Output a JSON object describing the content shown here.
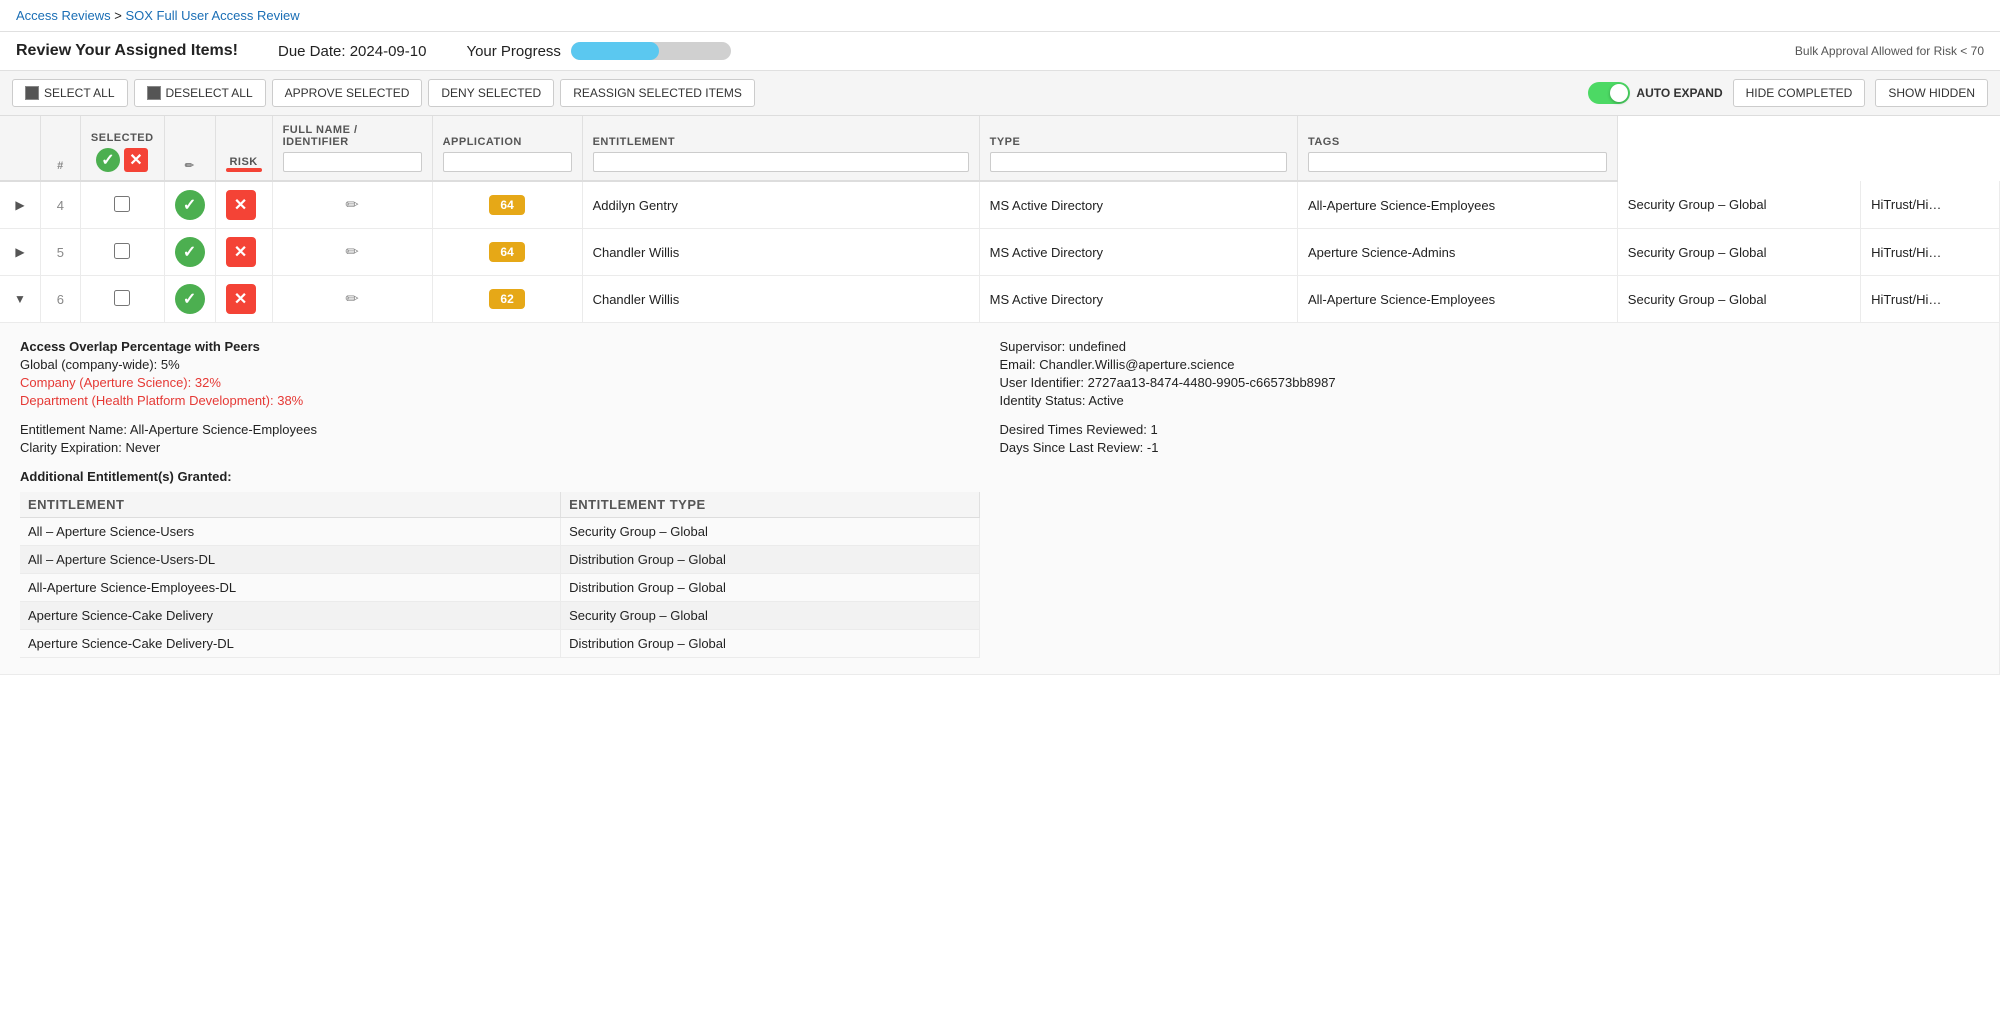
{
  "breadcrumb": {
    "parent_label": "Access Reviews",
    "parent_href": "#",
    "separator": ">",
    "current_label": "SOX Full User Access Review"
  },
  "header": {
    "title": "Review Your Assigned Items!",
    "due_date_label": "Due Date: 2024-09-10",
    "progress_label": "Your Progress",
    "progress_percent": 55,
    "bulk_approval_label": "Bulk Approval Allowed for Risk < 70"
  },
  "toolbar": {
    "select_all_label": "SELECT ALL",
    "deselect_all_label": "DESELECT ALL",
    "approve_selected_label": "APPROVE SELECTED",
    "deny_selected_label": "DENY SELECTED",
    "reassign_label": "REASSIGN SELECTED ITEMS",
    "auto_expand_label": "AUTO EXPAND",
    "hide_completed_label": "HIDE COMPLETED",
    "show_hidden_label": "SHOW HIDDEN"
  },
  "table": {
    "columns": {
      "num": "#",
      "selected": "SELECTED",
      "risk": "RISK",
      "full_name": "FULL NAME / IDENTIFIER",
      "application": "APPLICATION",
      "entitlement": "ENTITLEMENT",
      "type": "TYPE",
      "tags": "TAGS"
    },
    "rows": [
      {
        "id": 4,
        "selected": false,
        "risk": 64,
        "risk_class": "amber",
        "full_name": "Addilyn Gentry",
        "application": "MS Active Directory",
        "entitlement": "All-Aperture Science-Employees",
        "type": "Security Group – Global",
        "tags": "HiTrust/Hi…",
        "expanded": false
      },
      {
        "id": 5,
        "selected": false,
        "risk": 64,
        "risk_class": "amber",
        "full_name": "Chandler Willis",
        "application": "MS Active Directory",
        "entitlement": "Aperture Science-Admins",
        "type": "Security Group – Global",
        "tags": "HiTrust/Hi…",
        "expanded": false
      },
      {
        "id": 6,
        "selected": false,
        "risk": 62,
        "risk_class": "amber",
        "full_name": "Chandler Willis",
        "application": "MS Active Directory",
        "entitlement": "All-Aperture Science-Employees",
        "type": "Security Group – Global",
        "tags": "HiTrust/Hi…",
        "expanded": true
      }
    ]
  },
  "expanded_row": {
    "access_overlap": {
      "title": "Access Overlap Percentage with Peers",
      "global": "Global (company-wide): 5%",
      "company": "Company (Aperture Science): 32%",
      "department": "Department (Health Platform Development): 38%"
    },
    "user_info": {
      "supervisor": "Supervisor: undefined",
      "email": "Email: Chandler.Willis@aperture.science",
      "user_identifier": "User Identifier: 2727aa13-8474-4480-9905-c66573bb8987",
      "identity_status": "Identity Status: Active"
    },
    "entitlement_info": {
      "name": "Entitlement Name: All-Aperture Science-Employees",
      "expiration": "Clarity Expiration: Never"
    },
    "review_info": {
      "desired_times": "Desired Times Reviewed: 1",
      "days_since": "Days Since Last Review: -1"
    },
    "additional_entitlements": {
      "title": "Additional Entitlement(s) Granted:",
      "col_entitlement": "Entitlement",
      "col_type": "Entitlement Type",
      "rows": [
        {
          "entitlement": "All – Aperture Science-Users",
          "type": "Security Group – Global"
        },
        {
          "entitlement": "All – Aperture Science-Users-DL",
          "type": "Distribution Group – Global"
        },
        {
          "entitlement": "All-Aperture Science-Employees-DL",
          "type": "Distribution Group – Global"
        },
        {
          "entitlement": "Aperture Science-Cake Delivery",
          "type": "Security Group – Global"
        },
        {
          "entitlement": "Aperture Science-Cake Delivery-DL",
          "type": "Distribution Group – Global"
        }
      ]
    }
  }
}
